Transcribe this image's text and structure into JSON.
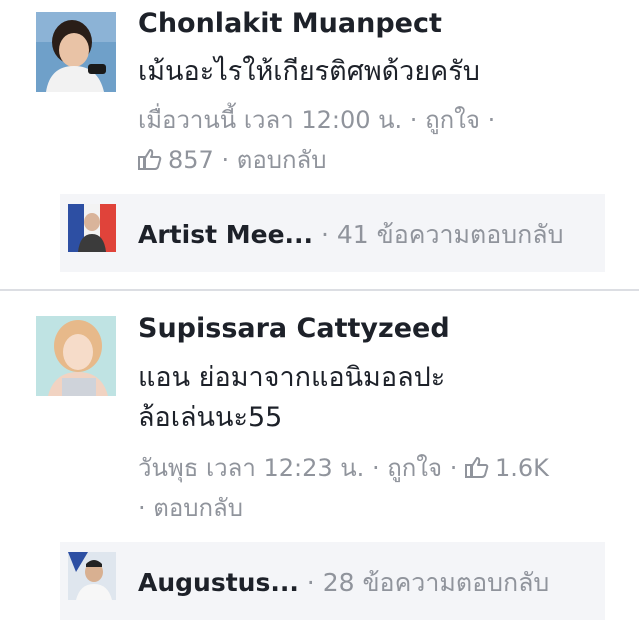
{
  "comments": [
    {
      "author": "Chonlakit Muanpect",
      "text_lines": [
        "เม้นอะไรให้เกียรติศพด้วยครับ"
      ],
      "timestamp": "เมื่อวานนี้ เวลา 12:00 น.",
      "like_label": "ถูกใจ",
      "like_count": "857",
      "reply_label": "ตอบกลับ",
      "reply_preview": {
        "name": "Artist Mee...",
        "count_text": "41 ข้อความตอบกลับ"
      }
    },
    {
      "author": "Supissara Cattyzeed",
      "text_lines": [
        "แอน ย่อมาจากแอนิมอลปะ",
        "ล้อเล่นนะ55"
      ],
      "timestamp": "วันพุธ เวลา 12:23 น.",
      "like_label": "ถูกใจ",
      "like_count": "1.6K",
      "reply_label": "ตอบกลับ",
      "reply_preview": {
        "name": "Augustus...",
        "count_text": "28 ข้อความตอบกลับ"
      }
    }
  ],
  "separator": "·",
  "colors": {
    "name": "#1d2129",
    "meta": "#90949c",
    "reply_bg": "#f4f5f8",
    "like_icon": "#90949c"
  },
  "icons": {
    "like": "thumbs-up-icon"
  }
}
